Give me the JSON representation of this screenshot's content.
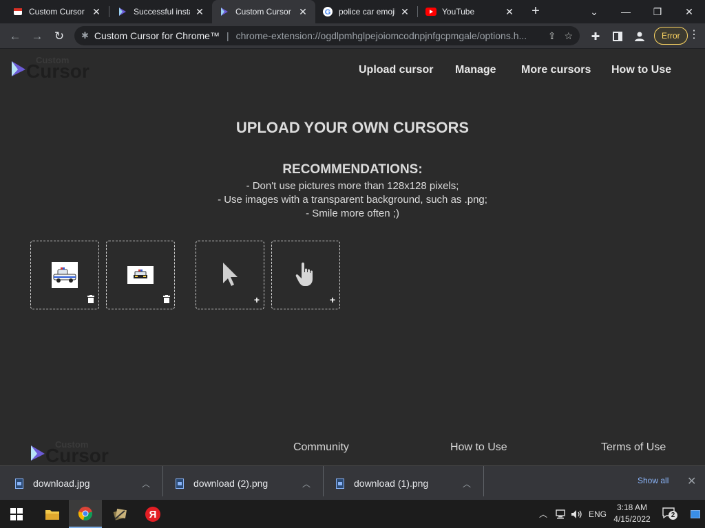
{
  "browser": {
    "tabs": [
      {
        "title": "Custom Cursor f",
        "favicon": "custom-cursor-red-icon"
      },
      {
        "title": "Successful insta",
        "favicon": "custom-cursor-arrow-icon"
      },
      {
        "title": "Custom Cursor",
        "favicon": "custom-cursor-arrow-icon",
        "active": true
      },
      {
        "title": "police car emoji",
        "favicon": "google-icon"
      },
      {
        "title": "YouTube",
        "favicon": "youtube-icon"
      }
    ],
    "address": {
      "site": "Custom Cursor for Chrome™",
      "url": "chrome-extension://ogdlpmhglpejoiomcodnpjnfgcpmgale/options.h..."
    },
    "profile_status": "Error"
  },
  "page": {
    "logo": {
      "line1": "Custom",
      "line2": "Cursor"
    },
    "nav": [
      "Upload cursor",
      "Manage",
      "More cursors",
      "How to Use"
    ],
    "headline": "UPLOAD YOUR OWN CURSORS",
    "recommendations": {
      "title": "RECOMMENDATIONS:",
      "lines": [
        "- Don't use pictures more than 128x128 pixels;",
        "- Use images with a transparent background, such as .png;",
        "- Smile more often ;)"
      ]
    },
    "footer": [
      "Community",
      "How to Use",
      "Terms of Use"
    ]
  },
  "downloads": {
    "items": [
      "download.jpg",
      "download (2).png",
      "download (1).png"
    ],
    "show_all": "Show all"
  },
  "taskbar": {
    "language": "ENG",
    "time": "3:18 AM",
    "date": "4/15/2022",
    "notifications": "2"
  },
  "colors": {
    "page_bg": "#2b2b2b",
    "tabstrip_bg": "#202124",
    "toolbar_bg": "#35363a",
    "error_yellow": "#fdd663",
    "link_blue": "#8ab4f8"
  }
}
